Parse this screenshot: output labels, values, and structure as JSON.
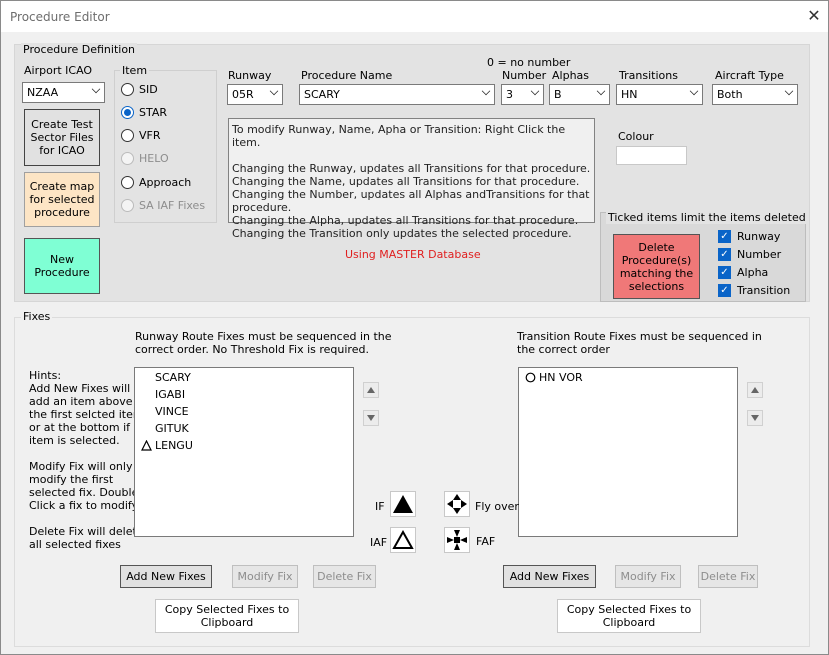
{
  "window": {
    "title": "Procedure Editor",
    "close_glyph": "✕"
  },
  "definition": {
    "group_title": "Procedure Definition",
    "airport_label": "Airport ICAO",
    "airport_value": "NZAA",
    "create_test_btn": "Create Test Sector Files for ICAO",
    "create_map_btn": "Create map for selected procedure",
    "new_procedure_btn": "New Procedure",
    "item_label": "Item",
    "items": [
      {
        "label": "SID",
        "selected": false,
        "enabled": true
      },
      {
        "label": "STAR",
        "selected": true,
        "enabled": true
      },
      {
        "label": "VFR",
        "selected": false,
        "enabled": true
      },
      {
        "label": "HELO",
        "selected": false,
        "enabled": false
      },
      {
        "label": "Approach",
        "selected": false,
        "enabled": true
      },
      {
        "label": "SA IAF Fixes",
        "selected": false,
        "enabled": false
      }
    ],
    "runway_label": "Runway",
    "runway_value": "05R",
    "name_label": "Procedure Name",
    "name_value": "SCARY",
    "number_note": "0 = no number",
    "number_label": "Number",
    "number_value": "3",
    "alphas_label": "Alphas",
    "alphas_value": "B",
    "transitions_label": "Transitions",
    "transitions_value": "HN",
    "aircraft_label": "Aircraft Type",
    "aircraft_value": "Both",
    "info_lines": [
      "To modify Runway, Name, Apha or Transition: Right Click the item.",
      "",
      "Changing the Runway, updates all Transitions for that procedure.",
      "Changing the Name, updates all Transitions for that procedure.",
      "Changing the Number, updates all Alphas andTransitions for that procedure.",
      "Changing the Alpha, updates all Transitions for that procedure.",
      "Changing the Transition only updates the selected procedure."
    ],
    "colour_label": "Colour",
    "database_status": "Using MASTER Database",
    "delete_group_title": "Ticked items limit the items deleted",
    "delete_btn": "Delete Procedure(s) matching the selections",
    "delete_checks": [
      {
        "label": "Runway",
        "checked": true
      },
      {
        "label": "Number",
        "checked": true
      },
      {
        "label": "Alpha",
        "checked": true
      },
      {
        "label": "Transition",
        "checked": true
      }
    ]
  },
  "fixes": {
    "group_title": "Fixes",
    "hints": [
      "Hints:",
      "Add New Fixes will",
      "add an item above",
      "the first selcted item",
      "or at the bottom if no",
      "item is selected.",
      "",
      "Modify Fix will only",
      "modify the first",
      "selected fix. Double",
      "Click a fix to modify.",
      "",
      "Delete Fix will delete",
      "all selected fixes"
    ],
    "runway_header_1": "Runway Route Fixes must be sequenced in the",
    "runway_header_2": "correct order. No Threshold Fix is required.",
    "runway_fixes": [
      {
        "name": "SCARY",
        "icon": ""
      },
      {
        "name": "IGABI",
        "icon": ""
      },
      {
        "name": "VINCE",
        "icon": ""
      },
      {
        "name": "GITUK",
        "icon": ""
      },
      {
        "name": "LENGU",
        "icon": "iaf-triangle-icon"
      }
    ],
    "transition_header_1": "Transition Route Fixes must be sequenced in",
    "transition_header_2": "the correct order",
    "transition_fixes": [
      {
        "name": "HN VOR",
        "icon": "circle-icon"
      }
    ],
    "legend": {
      "if": "IF",
      "iaf": "IAF",
      "flyover": "Fly over",
      "faf": "FAF"
    },
    "add_btn": "Add New Fixes",
    "modify_btn": "Modify Fix",
    "delete_btn": "Delete Fix",
    "copy_btn": "Copy Selected Fixes to Clipboard"
  },
  "colors": {
    "new_procedure": "#7fffd4",
    "create_map": "#fde5c5",
    "delete": "#f07878",
    "status_red": "#e02020",
    "check_blue": "#0a64c8"
  }
}
